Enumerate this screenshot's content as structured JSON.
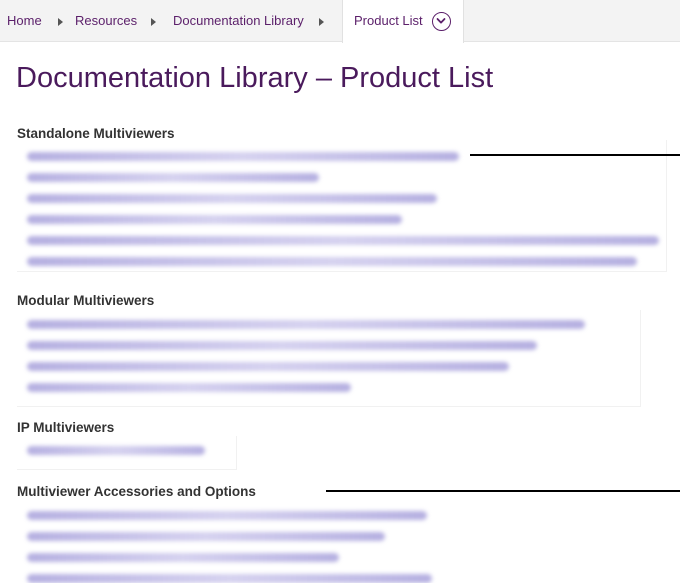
{
  "breadcrumb": {
    "items": [
      {
        "label": "Home"
      },
      {
        "label": "Resources"
      },
      {
        "label": "Documentation Library"
      }
    ],
    "current": "Product List",
    "current_icon": "chevron-down-circle-icon"
  },
  "page": {
    "title": "Documentation Library – Product List"
  },
  "sections": [
    {
      "heading": "Standalone Multiviewers"
    },
    {
      "heading": "Modular Multiviewers"
    },
    {
      "heading": "IP Multiviewers"
    },
    {
      "heading": "Multiviewer Accessories and Options"
    }
  ],
  "colors": {
    "brand_purple": "#5b1f6a",
    "title_purple": "#4a1a5c",
    "link_blurred": "#7a6fc8",
    "breadcrumb_bg": "#f3f3f3"
  }
}
